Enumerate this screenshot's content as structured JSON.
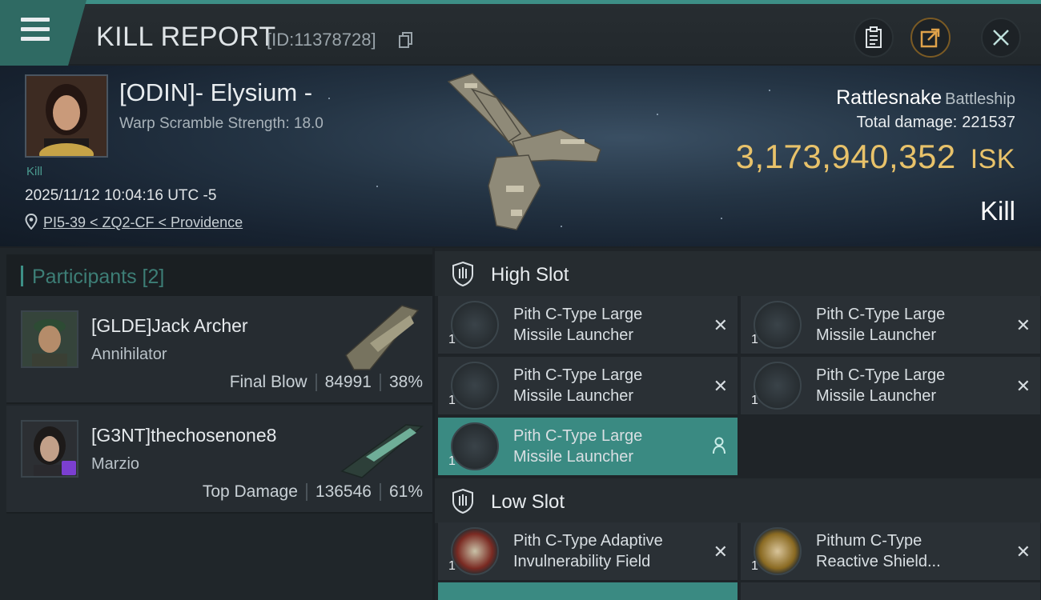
{
  "header": {
    "title": "KILL REPORT",
    "id_text": "[ID:11378728]"
  },
  "victim": {
    "name": "[ODIN]- Elysium -",
    "subline": "Warp Scramble Strength: 18.0",
    "tag": "Kill",
    "time": "2025/11/12 10:04:16 UTC -5",
    "location": "PI5-39 < ZQ2-CF < Providence"
  },
  "ship": {
    "name": "Rattlesnake",
    "class": "Battleship",
    "total_damage_label": "Total damage:",
    "total_damage": "221537",
    "isk_value": "3,173,940,352",
    "isk_unit": "ISK",
    "result": "Kill"
  },
  "participants": {
    "title": "Participants [2]",
    "rows": [
      {
        "name": "[GLDE]Jack Archer",
        "ship": "Annihilator",
        "role": "Final Blow",
        "damage": "84991",
        "percent": "38%"
      },
      {
        "name": "[G3NT]thechosenone8",
        "ship": "Marzio",
        "role": "Top Damage",
        "damage": "136546",
        "percent": "61%"
      }
    ]
  },
  "high_slot": {
    "title": "High Slot",
    "modules": [
      {
        "line1": "Pith C-Type Large",
        "line2": "Missile Launcher",
        "qty": "1"
      },
      {
        "line1": "Pith C-Type Large",
        "line2": "Missile Launcher",
        "qty": "1"
      },
      {
        "line1": "Pith C-Type Large",
        "line2": "Missile Launcher",
        "qty": "1"
      },
      {
        "line1": "Pith C-Type Large",
        "line2": "Missile Launcher",
        "qty": "1"
      },
      {
        "line1": "Pith C-Type Large",
        "line2": "Missile Launcher",
        "qty": "1"
      }
    ]
  },
  "low_slot": {
    "title": "Low Slot",
    "modules": [
      {
        "line1": "Pith C-Type Adaptive",
        "line2": "Invulnerability Field",
        "qty": "1"
      },
      {
        "line1": "Pithum C-Type",
        "line2": "Reactive Shield...",
        "qty": "1"
      }
    ]
  },
  "colors": {
    "accent": "#3d8f86",
    "isk": "#e8c26a",
    "selected": "#3a8a82"
  },
  "icons": [
    "menu-icon",
    "copy-icon",
    "clipboard-icon",
    "share-icon",
    "close-icon",
    "pin-icon",
    "shield-icon",
    "person-icon",
    "remove-icon"
  ]
}
